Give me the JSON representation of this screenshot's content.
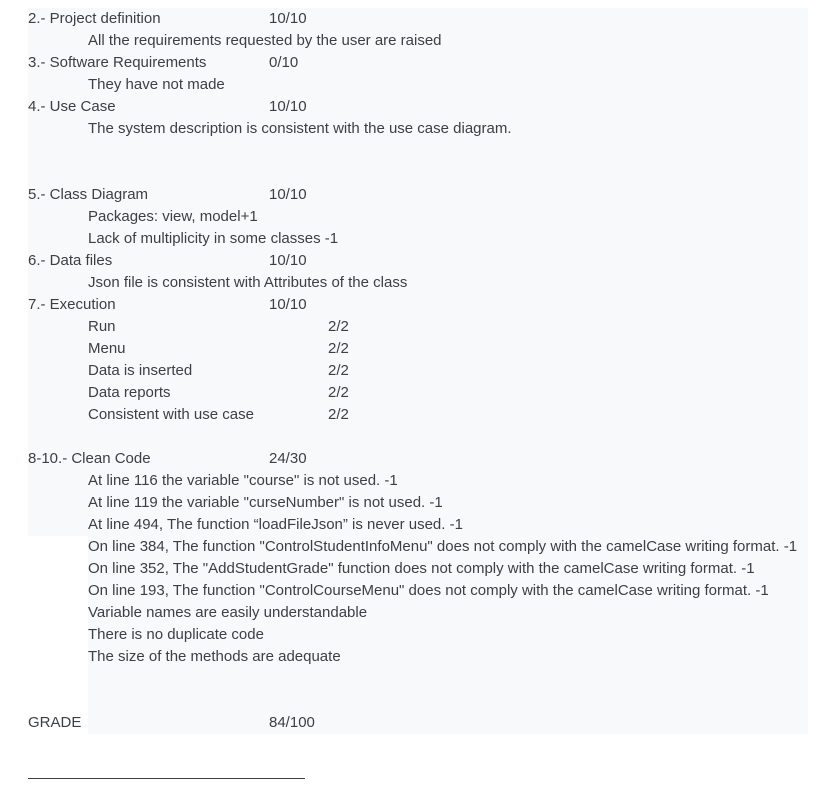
{
  "sections": [
    {
      "label": "2.- Project definition",
      "score": "10/10",
      "notes": [
        "All the requirements requested by the user are raised"
      ]
    },
    {
      "label": "3.- Software Requirements",
      "score": "0/10",
      "notes": [
        "They have not made"
      ]
    },
    {
      "label": "4.- Use Case",
      "score": "10/10",
      "notes": [
        "The system description is consistent with the use case diagram."
      ]
    },
    {
      "label": "5.- Class Diagram",
      "score": "10/10",
      "notes": [
        "Packages: view, model+1",
        "Lack of multiplicity in some classes -1"
      ]
    },
    {
      "label": "6.- Data files",
      "score": "10/10",
      "notes": [
        "Json file is consistent with Attributes of the class"
      ]
    },
    {
      "label": "7.- Execution",
      "score": "10/10",
      "items": [
        {
          "label": "Run",
          "score": "2/2"
        },
        {
          "label": "Menu",
          "score": "2/2"
        },
        {
          "label": "Data is inserted",
          "score": "2/2"
        },
        {
          "label": "Data reports",
          "score": "2/2"
        },
        {
          "label": "Consistent with use case",
          "score": "2/2"
        }
      ]
    },
    {
      "label": "8-10.- Clean Code",
      "score": "24/30",
      "notes": [
        "At line 116 the variable \"course\" is not used. -1",
        "At line 119 the variable \"curseNumber\" is not used. -1",
        "At line 494, The function “loadFileJson” is never used. -1",
        "On line 384, The function \"ControlStudentInfoMenu\" does not comply with the camelCase writing format. -1",
        "On line 352, The \"AddStudentGrade\" function does not comply with the camelCase writing format. -1",
        "On line 193, The function \"ControlCourseMenu\" does not comply with the camelCase writing format. -1",
        "Variable names are easily understandable",
        "There is no duplicate code",
        "The size of the methods are adequate"
      ]
    }
  ],
  "grade": {
    "label": "GRADE",
    "score": "84/100"
  }
}
